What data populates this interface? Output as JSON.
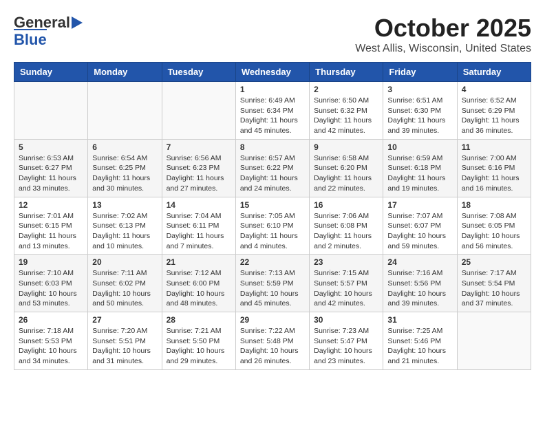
{
  "header": {
    "logo_general": "General",
    "logo_blue": "Blue",
    "title": "October 2025",
    "subtitle": "West Allis, Wisconsin, United States"
  },
  "days_of_week": [
    "Sunday",
    "Monday",
    "Tuesday",
    "Wednesday",
    "Thursday",
    "Friday",
    "Saturday"
  ],
  "weeks": [
    [
      {
        "day": "",
        "info": ""
      },
      {
        "day": "",
        "info": ""
      },
      {
        "day": "",
        "info": ""
      },
      {
        "day": "1",
        "info": "Sunrise: 6:49 AM\nSunset: 6:34 PM\nDaylight: 11 hours\nand 45 minutes."
      },
      {
        "day": "2",
        "info": "Sunrise: 6:50 AM\nSunset: 6:32 PM\nDaylight: 11 hours\nand 42 minutes."
      },
      {
        "day": "3",
        "info": "Sunrise: 6:51 AM\nSunset: 6:30 PM\nDaylight: 11 hours\nand 39 minutes."
      },
      {
        "day": "4",
        "info": "Sunrise: 6:52 AM\nSunset: 6:29 PM\nDaylight: 11 hours\nand 36 minutes."
      }
    ],
    [
      {
        "day": "5",
        "info": "Sunrise: 6:53 AM\nSunset: 6:27 PM\nDaylight: 11 hours\nand 33 minutes."
      },
      {
        "day": "6",
        "info": "Sunrise: 6:54 AM\nSunset: 6:25 PM\nDaylight: 11 hours\nand 30 minutes."
      },
      {
        "day": "7",
        "info": "Sunrise: 6:56 AM\nSunset: 6:23 PM\nDaylight: 11 hours\nand 27 minutes."
      },
      {
        "day": "8",
        "info": "Sunrise: 6:57 AM\nSunset: 6:22 PM\nDaylight: 11 hours\nand 24 minutes."
      },
      {
        "day": "9",
        "info": "Sunrise: 6:58 AM\nSunset: 6:20 PM\nDaylight: 11 hours\nand 22 minutes."
      },
      {
        "day": "10",
        "info": "Sunrise: 6:59 AM\nSunset: 6:18 PM\nDaylight: 11 hours\nand 19 minutes."
      },
      {
        "day": "11",
        "info": "Sunrise: 7:00 AM\nSunset: 6:16 PM\nDaylight: 11 hours\nand 16 minutes."
      }
    ],
    [
      {
        "day": "12",
        "info": "Sunrise: 7:01 AM\nSunset: 6:15 PM\nDaylight: 11 hours\nand 13 minutes."
      },
      {
        "day": "13",
        "info": "Sunrise: 7:02 AM\nSunset: 6:13 PM\nDaylight: 11 hours\nand 10 minutes."
      },
      {
        "day": "14",
        "info": "Sunrise: 7:04 AM\nSunset: 6:11 PM\nDaylight: 11 hours\nand 7 minutes."
      },
      {
        "day": "15",
        "info": "Sunrise: 7:05 AM\nSunset: 6:10 PM\nDaylight: 11 hours\nand 4 minutes."
      },
      {
        "day": "16",
        "info": "Sunrise: 7:06 AM\nSunset: 6:08 PM\nDaylight: 11 hours\nand 2 minutes."
      },
      {
        "day": "17",
        "info": "Sunrise: 7:07 AM\nSunset: 6:07 PM\nDaylight: 10 hours\nand 59 minutes."
      },
      {
        "day": "18",
        "info": "Sunrise: 7:08 AM\nSunset: 6:05 PM\nDaylight: 10 hours\nand 56 minutes."
      }
    ],
    [
      {
        "day": "19",
        "info": "Sunrise: 7:10 AM\nSunset: 6:03 PM\nDaylight: 10 hours\nand 53 minutes."
      },
      {
        "day": "20",
        "info": "Sunrise: 7:11 AM\nSunset: 6:02 PM\nDaylight: 10 hours\nand 50 minutes."
      },
      {
        "day": "21",
        "info": "Sunrise: 7:12 AM\nSunset: 6:00 PM\nDaylight: 10 hours\nand 48 minutes."
      },
      {
        "day": "22",
        "info": "Sunrise: 7:13 AM\nSunset: 5:59 PM\nDaylight: 10 hours\nand 45 minutes."
      },
      {
        "day": "23",
        "info": "Sunrise: 7:15 AM\nSunset: 5:57 PM\nDaylight: 10 hours\nand 42 minutes."
      },
      {
        "day": "24",
        "info": "Sunrise: 7:16 AM\nSunset: 5:56 PM\nDaylight: 10 hours\nand 39 minutes."
      },
      {
        "day": "25",
        "info": "Sunrise: 7:17 AM\nSunset: 5:54 PM\nDaylight: 10 hours\nand 37 minutes."
      }
    ],
    [
      {
        "day": "26",
        "info": "Sunrise: 7:18 AM\nSunset: 5:53 PM\nDaylight: 10 hours\nand 34 minutes."
      },
      {
        "day": "27",
        "info": "Sunrise: 7:20 AM\nSunset: 5:51 PM\nDaylight: 10 hours\nand 31 minutes."
      },
      {
        "day": "28",
        "info": "Sunrise: 7:21 AM\nSunset: 5:50 PM\nDaylight: 10 hours\nand 29 minutes."
      },
      {
        "day": "29",
        "info": "Sunrise: 7:22 AM\nSunset: 5:48 PM\nDaylight: 10 hours\nand 26 minutes."
      },
      {
        "day": "30",
        "info": "Sunrise: 7:23 AM\nSunset: 5:47 PM\nDaylight: 10 hours\nand 23 minutes."
      },
      {
        "day": "31",
        "info": "Sunrise: 7:25 AM\nSunset: 5:46 PM\nDaylight: 10 hours\nand 21 minutes."
      },
      {
        "day": "",
        "info": ""
      }
    ]
  ]
}
